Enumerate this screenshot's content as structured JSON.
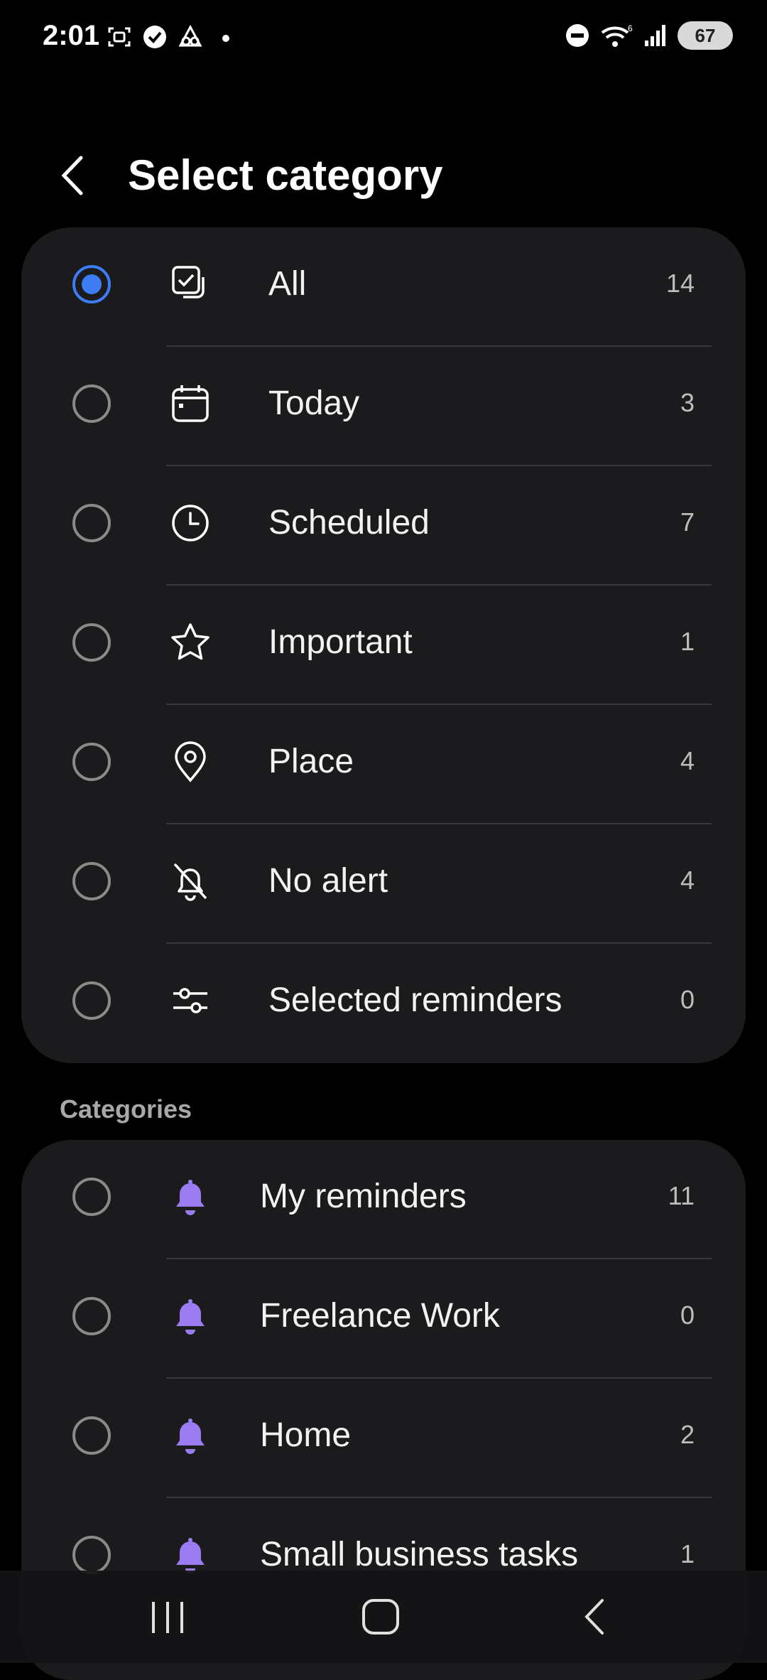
{
  "status_bar": {
    "time": "2:01",
    "battery": "67",
    "icons": [
      "screenshot-icon",
      "check-circle-icon",
      "cloud-icon",
      "dot-icon",
      "do-not-disturb-icon",
      "wifi-icon",
      "signal-icon",
      "battery-icon"
    ]
  },
  "header": {
    "title": "Select category",
    "back_icon": "chevron-left-icon"
  },
  "filters": [
    {
      "label": "All",
      "count": "14",
      "icon": "checklist-icon",
      "selected": true
    },
    {
      "label": "Today",
      "count": "3",
      "icon": "calendar-icon",
      "selected": false
    },
    {
      "label": "Scheduled",
      "count": "7",
      "icon": "clock-icon",
      "selected": false
    },
    {
      "label": "Important",
      "count": "1",
      "icon": "star-icon",
      "selected": false
    },
    {
      "label": "Place",
      "count": "4",
      "icon": "location-pin-icon",
      "selected": false
    },
    {
      "label": "No alert",
      "count": "4",
      "icon": "bell-off-icon",
      "selected": false
    },
    {
      "label": "Selected reminders",
      "count": "0",
      "icon": "sliders-icon",
      "selected": false
    }
  ],
  "categories_header": "Categories",
  "categories": [
    {
      "label": "My reminders",
      "count": "11",
      "icon": "bell-icon"
    },
    {
      "label": "Freelance Work",
      "count": "0",
      "icon": "bell-icon"
    },
    {
      "label": "Home",
      "count": "2",
      "icon": "bell-icon"
    },
    {
      "label": "Small business tasks",
      "count": "1",
      "icon": "bell-icon"
    }
  ],
  "colors": {
    "accent": "#3d7cf5",
    "category_bell": "#9b7bf0",
    "card_bg": "#1b1b1d"
  },
  "nav_bar": {
    "icons": [
      "recents-icon",
      "home-icon",
      "back-icon"
    ]
  }
}
